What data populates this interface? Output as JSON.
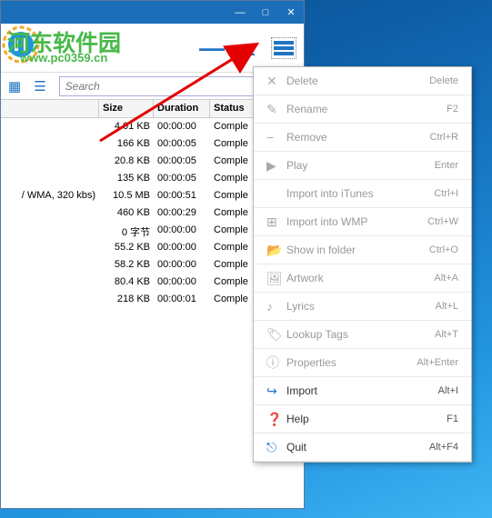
{
  "watermark": {
    "text": "河东软件园",
    "url": "www.pc0359.cn"
  },
  "titlebar": {
    "min": "—",
    "max": "□",
    "close": "✕"
  },
  "toolbar": {
    "dash": "—"
  },
  "search": {
    "placeholder": "Search"
  },
  "columns": {
    "size": "Size",
    "duration": "Duration",
    "status": "Status"
  },
  "rows": [
    {
      "file": "",
      "size": "4.01 KB",
      "duration": "00:00:00",
      "status": "Comple"
    },
    {
      "file": "",
      "size": "166 KB",
      "duration": "00:00:05",
      "status": "Comple"
    },
    {
      "file": "",
      "size": "20.8 KB",
      "duration": "00:00:05",
      "status": "Comple"
    },
    {
      "file": "",
      "size": "135 KB",
      "duration": "00:00:05",
      "status": "Comple"
    },
    {
      "file": "/ WMA, 320 kbs)",
      "size": "10.5 MB",
      "duration": "00:00:51",
      "status": "Comple"
    },
    {
      "file": "",
      "size": "460 KB",
      "duration": "00:00:29",
      "status": "Comple"
    },
    {
      "file": "",
      "size": "0 字节",
      "duration": "00:00:00",
      "status": "Comple"
    },
    {
      "file": "",
      "size": "55.2 KB",
      "duration": "00:00:00",
      "status": "Comple"
    },
    {
      "file": "",
      "size": "58.2 KB",
      "duration": "00:00:00",
      "status": "Comple"
    },
    {
      "file": "",
      "size": "80.4 KB",
      "duration": "00:00:00",
      "status": "Comple"
    },
    {
      "file": "",
      "size": "218 KB",
      "duration": "00:00:01",
      "status": "Comple"
    }
  ],
  "menu": [
    {
      "icon": "delete-icon",
      "glyph": "✕",
      "label": "Delete",
      "shortcut": "Delete",
      "active": false
    },
    {
      "icon": "rename-icon",
      "glyph": "✎",
      "label": "Rename",
      "shortcut": "F2",
      "active": false
    },
    {
      "icon": "remove-icon",
      "glyph": "−",
      "label": "Remove",
      "shortcut": "Ctrl+R",
      "active": false
    },
    {
      "icon": "play-icon",
      "glyph": "▶",
      "label": "Play",
      "shortcut": "Enter",
      "active": false
    },
    {
      "icon": "apple-icon",
      "glyph": "",
      "label": "Import into iTunes",
      "shortcut": "Ctrl+I",
      "active": false
    },
    {
      "icon": "windows-icon",
      "glyph": "⊞",
      "label": "Import into WMP",
      "shortcut": "Ctrl+W",
      "active": false
    },
    {
      "icon": "folder-icon",
      "glyph": "📂",
      "label": "Show in folder",
      "shortcut": "Ctrl+O",
      "active": false
    },
    {
      "icon": "artwork-icon",
      "glyph": "🖼",
      "label": "Artwork",
      "shortcut": "Alt+A",
      "active": false
    },
    {
      "icon": "lyrics-icon",
      "glyph": "♪",
      "label": "Lyrics",
      "shortcut": "Alt+L",
      "active": false
    },
    {
      "icon": "tag-icon",
      "glyph": "🏷",
      "label": "Lookup Tags",
      "shortcut": "Alt+T",
      "active": false
    },
    {
      "icon": "info-icon",
      "glyph": "ⓘ",
      "label": "Properties",
      "shortcut": "Alt+Enter",
      "active": false
    },
    {
      "icon": "import-icon",
      "glyph": "↪",
      "label": "Import",
      "shortcut": "Alt+I",
      "active": true
    },
    {
      "icon": "help-icon",
      "glyph": "❓",
      "label": "Help",
      "shortcut": "F1",
      "active": true
    },
    {
      "icon": "quit-icon",
      "glyph": "⎋",
      "label": "Quit",
      "shortcut": "Alt+F4",
      "active": true
    }
  ]
}
